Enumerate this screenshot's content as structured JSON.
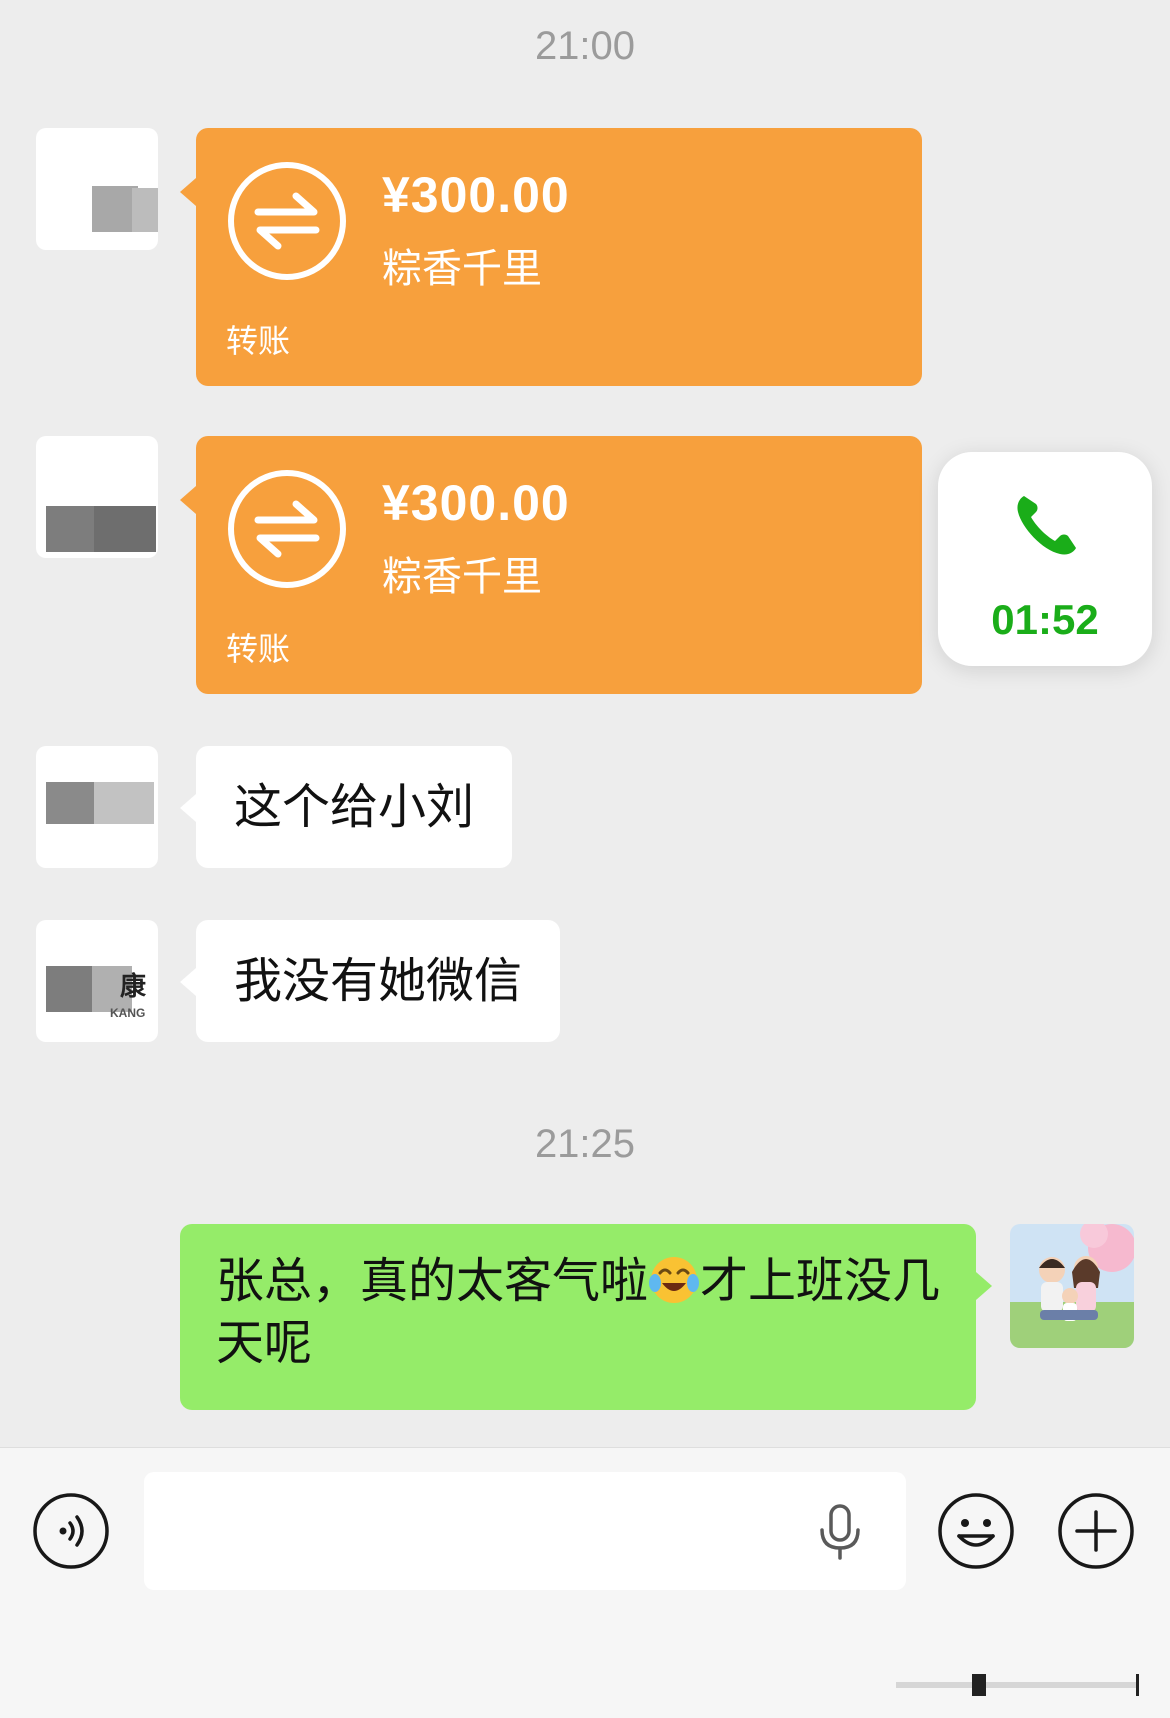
{
  "chat": {
    "time_divider_1": "21:00",
    "time_divider_2": "21:25",
    "transfers": [
      {
        "amount": "¥300.00",
        "name": "粽香千里",
        "label": "转账"
      },
      {
        "amount": "¥300.00",
        "name": "粽香千里",
        "label": "转账"
      }
    ],
    "messages_in": [
      {
        "text": "这个给小刘"
      },
      {
        "text": "我没有她微信"
      }
    ],
    "message_out": {
      "text_before_emoji": "张总，真的太客气啦",
      "emoji": "face-crying-laughing-emoji",
      "text_after_emoji": "才上班没几天呢"
    },
    "avatar_texts": {
      "avatar4_char": "康",
      "avatar4_sub": "KANG"
    }
  },
  "call_widget": {
    "duration": "01:52",
    "icon": "phone-icon",
    "color": "#1aad19"
  },
  "input_bar": {
    "placeholder": "",
    "voice_icon": "voice-mode-icon",
    "mic_icon": "microphone-icon",
    "emoji_icon": "emoji-icon",
    "more_icon": "plus-icon"
  },
  "colors": {
    "transfer_orange": "#f7a03d",
    "sent_green": "#95ec69",
    "background": "#ededed"
  }
}
